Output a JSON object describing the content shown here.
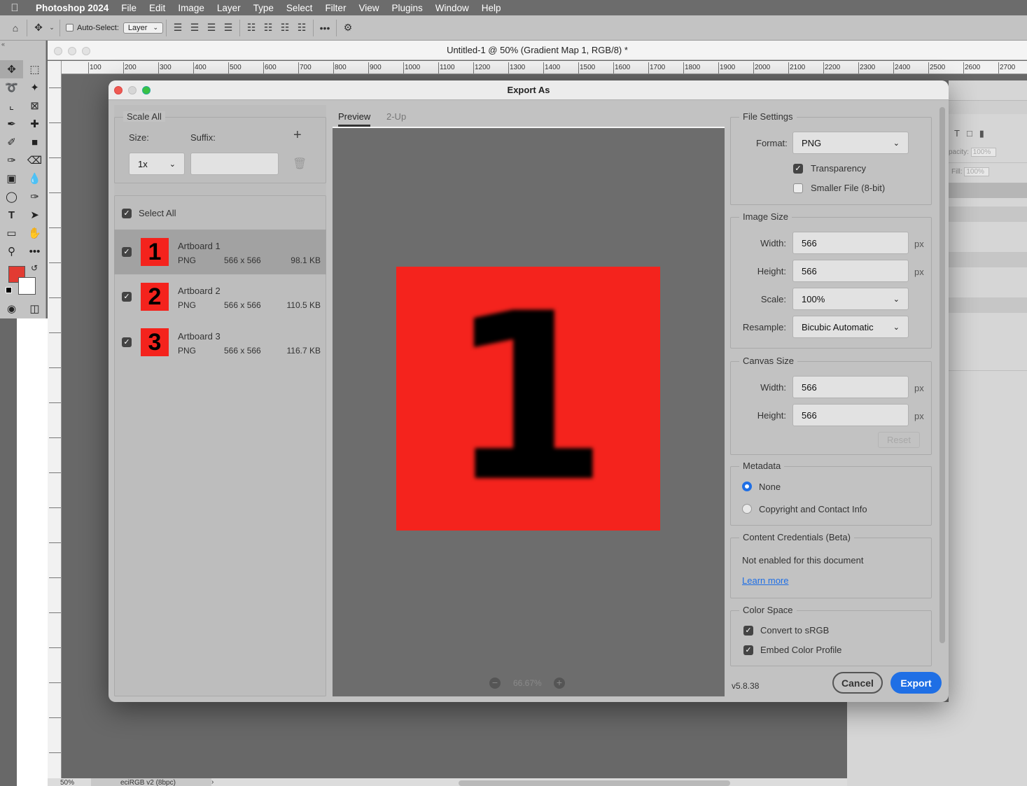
{
  "menubar": {
    "app": "Photoshop 2024",
    "items": [
      "File",
      "Edit",
      "Image",
      "Layer",
      "Type",
      "Select",
      "Filter",
      "View",
      "Plugins",
      "Window",
      "Help"
    ]
  },
  "options_bar": {
    "auto_select_label": "Auto-Select:",
    "auto_select_target": "Layer"
  },
  "document": {
    "title": "Untitled-1 @ 50% (Gradient Map 1, RGB/8) *",
    "ruler_ticks": [
      "100",
      "200",
      "300",
      "400",
      "500",
      "600",
      "700",
      "800",
      "900",
      "1000",
      "1100",
      "1200",
      "1300",
      "1400",
      "1500",
      "1600",
      "1700",
      "1800",
      "1900",
      "2000",
      "2100",
      "2200",
      "2300",
      "2400",
      "2500",
      "2600",
      "2700"
    ],
    "zoom_status": "50%",
    "profile_status": "eciRGB v2 (8bpc)"
  },
  "side_panel": {
    "opacity_label": "pacity:",
    "opacity_value": "100%",
    "fill_label": "Fill:",
    "fill_value": "100%"
  },
  "dialog": {
    "title": "Export As",
    "scale_all": {
      "legend": "Scale All",
      "size_label": "Size:",
      "suffix_label": "Suffix:",
      "size_value": "1x",
      "suffix_value": ""
    },
    "select_all_label": "Select All",
    "artboards": [
      {
        "name": "Artboard 1",
        "digit": "1",
        "format": "PNG",
        "dimensions": "566 x 566",
        "file_size": "98.1 KB",
        "selected": true
      },
      {
        "name": "Artboard 2",
        "digit": "2",
        "format": "PNG",
        "dimensions": "566 x 566",
        "file_size": "110.5 KB",
        "selected": false
      },
      {
        "name": "Artboard 3",
        "digit": "3",
        "format": "PNG",
        "dimensions": "566 x 566",
        "file_size": "116.7 KB",
        "selected": false
      }
    ],
    "tabs": {
      "preview": "Preview",
      "two_up": "2-Up"
    },
    "preview_digit": "1",
    "zoom_value": "66.67%",
    "file_settings": {
      "legend": "File Settings",
      "format_label": "Format:",
      "format_value": "PNG",
      "transparency_label": "Transparency",
      "transparency_checked": true,
      "smaller_file_label": "Smaller File (8-bit)",
      "smaller_file_checked": false
    },
    "image_size": {
      "legend": "Image Size",
      "width_label": "Width:",
      "width_value": "566",
      "height_label": "Height:",
      "height_value": "566",
      "scale_label": "Scale:",
      "scale_value": "100%",
      "resample_label": "Resample:",
      "resample_value": "Bicubic Automatic",
      "unit": "px"
    },
    "canvas_size": {
      "legend": "Canvas Size",
      "width_label": "Width:",
      "width_value": "566",
      "height_label": "Height:",
      "height_value": "566",
      "unit": "px",
      "reset_label": "Reset"
    },
    "metadata": {
      "legend": "Metadata",
      "none_label": "None",
      "copyright_label": "Copyright and Contact Info",
      "selected": "None"
    },
    "content_credentials": {
      "legend": "Content Credentials (Beta)",
      "status": "Not enabled for this document",
      "learn_more": "Learn more"
    },
    "color_space": {
      "legend": "Color Space",
      "convert_label": "Convert to sRGB",
      "embed_label": "Embed Color Profile"
    },
    "version": "v5.8.38",
    "cancel_label": "Cancel",
    "export_label": "Export"
  },
  "colors": {
    "accent": "#1f6fe5",
    "artboard_red": "#f4231d",
    "foreground_swatch": "#e23b32"
  }
}
